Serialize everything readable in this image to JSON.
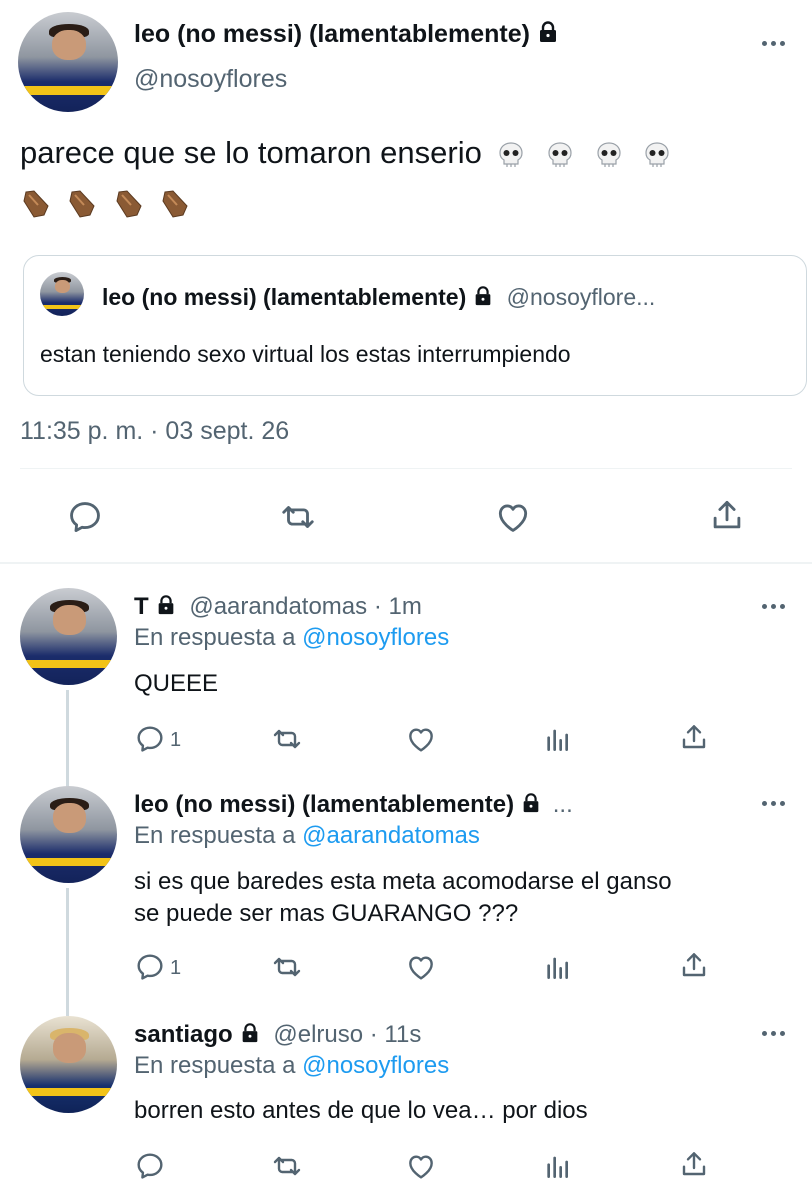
{
  "main_tweet": {
    "name": "leo (no messi) (lamentablemente)",
    "handle": "@nosoyflores",
    "text": "parece que se lo tomaron enserio",
    "emoji_line1": [
      "skull",
      "skull",
      "skull",
      "skull"
    ],
    "emoji_line2": [
      "coffin",
      "coffin",
      "coffin",
      "coffin"
    ],
    "timestamp": "11:35 p. m. · 03 sept. 26",
    "quote": {
      "name": "leo (no messi) (lamentablemente)",
      "handle": "@nosoyflore...",
      "text": "estan teniendo sexo virtual los estas interrumpiendo"
    }
  },
  "replies": [
    {
      "name": "T",
      "handle": "@aarandatomas",
      "time": "· 1m",
      "reply_prefix": "En respuesta a",
      "reply_to": "@nosoyflores",
      "text": "QUEEE",
      "reply_count": "1"
    },
    {
      "name": "leo (no messi) (lamentablemente)",
      "ellipsis": "...",
      "reply_prefix": "En respuesta a",
      "reply_to": "@aarandatomas",
      "text_line1": "si es que baredes esta meta acomodarse el ganso",
      "text_line2": "se puede ser mas GUARANGO ???",
      "reply_count": "1"
    },
    {
      "name": "santiago",
      "handle": "@elruso",
      "time": "· 11s",
      "reply_prefix": "En respuesta a",
      "reply_to": "@nosoyflores",
      "text": "borren esto antes de que lo vea… por dios"
    }
  ],
  "colors": {
    "link": "#1d9bf0",
    "secondary": "#536471",
    "border": "#cfd9de"
  },
  "icons": [
    "lock-icon",
    "more-icon",
    "reply-icon",
    "retweet-icon",
    "like-icon",
    "share-icon",
    "analytics-icon"
  ]
}
